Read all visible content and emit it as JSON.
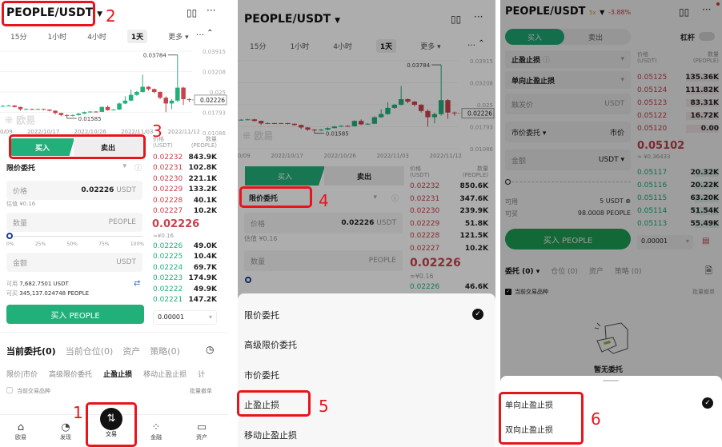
{
  "pair": "PEOPLE/USDT",
  "timeframes": [
    "15分",
    "1小时",
    "4小时",
    "1天",
    "更多"
  ],
  "selected_timeframe": "1天",
  "chart": {
    "type": "candlestick",
    "y_ticks": [
      "0.03915",
      "0.03208",
      "0.025",
      "0.01793",
      "0.01086"
    ],
    "x_ticks": [
      "0/09",
      "2022/10/17",
      "2022/10/26",
      "2022/11/03",
      "2022/11/12"
    ],
    "ylim": [
      0.01086,
      0.03915
    ],
    "high_label": "0.03784",
    "low_label": "0.01585",
    "last_price_label": "0.02226",
    "watermark": "欧易",
    "up_color": "#21b07a",
    "down_color": "#c9434c",
    "candles": [
      [
        0.02,
        0.0202,
        0.0204,
        0.0199
      ],
      [
        0.0202,
        0.0203,
        0.0205,
        0.02
      ],
      [
        0.0203,
        0.0198,
        0.0205,
        0.0196
      ],
      [
        0.0198,
        0.019,
        0.0199,
        0.0185
      ],
      [
        0.019,
        0.0191,
        0.0193,
        0.0188
      ],
      [
        0.0191,
        0.019,
        0.0192,
        0.0188
      ],
      [
        0.019,
        0.0191,
        0.0192,
        0.0189
      ],
      [
        0.0191,
        0.0189,
        0.0192,
        0.0187
      ],
      [
        0.0189,
        0.0185,
        0.019,
        0.0183
      ],
      [
        0.0185,
        0.0177,
        0.0186,
        0.0172
      ],
      [
        0.0177,
        0.017,
        0.0178,
        0.0166
      ],
      [
        0.017,
        0.0168,
        0.0172,
        0.01585
      ],
      [
        0.0168,
        0.017,
        0.0172,
        0.0165
      ],
      [
        0.017,
        0.0175,
        0.0177,
        0.0168
      ],
      [
        0.0175,
        0.018,
        0.0182,
        0.0174
      ],
      [
        0.018,
        0.0182,
        0.0184,
        0.0178
      ],
      [
        0.0182,
        0.0181,
        0.0184,
        0.0179
      ],
      [
        0.0181,
        0.0198,
        0.02,
        0.018
      ],
      [
        0.0198,
        0.0187,
        0.0203,
        0.0185
      ],
      [
        0.0187,
        0.0189,
        0.0191,
        0.0186
      ],
      [
        0.0189,
        0.021,
        0.0213,
        0.0188
      ],
      [
        0.021,
        0.022,
        0.0235,
        0.0208
      ],
      [
        0.022,
        0.024,
        0.0258,
        0.0218
      ],
      [
        0.024,
        0.025,
        0.0253,
        0.0237
      ],
      [
        0.025,
        0.0268,
        0.031,
        0.0248
      ],
      [
        0.0268,
        0.026,
        0.027,
        0.0255
      ],
      [
        0.026,
        0.025,
        0.0262,
        0.0245
      ],
      [
        0.025,
        0.023,
        0.0252,
        0.0225
      ],
      [
        0.023,
        0.021,
        0.0235,
        0.018
      ],
      [
        0.021,
        0.022,
        0.0225,
        0.019
      ],
      [
        0.022,
        0.0265,
        0.03784,
        0.0215
      ],
      [
        0.0265,
        0.0225,
        0.0268,
        0.0205
      ],
      [
        0.0225,
        0.02226,
        0.0228,
        0.0215
      ]
    ]
  },
  "buy": "买入",
  "sell": "卖出",
  "order_type": "限价委托",
  "price_label": "价格",
  "price_value": "0.02226",
  "unit_usdt": "USDT",
  "unit_people": "PEOPLE",
  "estimate": "估值 ¥0.16",
  "qty_label": "数量",
  "amount_label": "金额",
  "slider": [
    "0%",
    "25%",
    "50%",
    "75%",
    "100%"
  ],
  "avail_label": "可用",
  "avail_value": "7,682.7501 USDT",
  "canbuy_label": "可买",
  "canbuy_value": "345,137.024748 PEOPLE",
  "buy_button": "买入 PEOPLE",
  "ob_head": {
    "price": "价格",
    "price_unit": "(USDT)",
    "qty": "数量",
    "qty_unit": "(PEOPLE)"
  },
  "p1": {
    "asks": [
      [
        "0.02232",
        "843.9K"
      ],
      [
        "0.02231",
        "102.8K"
      ],
      [
        "0.02230",
        "221.1K"
      ],
      [
        "0.02229",
        "133.2K"
      ],
      [
        "0.02228",
        "40.1K"
      ],
      [
        "0.02227",
        "10.2K"
      ]
    ],
    "mid": "0.02226",
    "mid_cny": "≈¥0.16",
    "bids": [
      [
        "0.02226",
        "49.0K"
      ],
      [
        "0.02225",
        "10.4K"
      ],
      [
        "0.02224",
        "69.7K"
      ],
      [
        "0.02223",
        "174.9K"
      ],
      [
        "0.02222",
        "49.9K"
      ],
      [
        "0.02221",
        "147.2K"
      ]
    ],
    "tick": "0.00001",
    "tabs": [
      "当前委托(0)",
      "当前仓位(0)",
      "资产",
      "策略(0)"
    ],
    "subtabs": [
      "限价|市价",
      "高级限价委托",
      "止盈止损",
      "移动止盈止损",
      "计"
    ],
    "current_pair": "当前交易品种",
    "batch_cancel": "批量撤单",
    "nav": [
      "欧易",
      "发现",
      "交易",
      "金融",
      "资产"
    ]
  },
  "p2": {
    "asks": [
      [
        "0.02232",
        "850.6K"
      ],
      [
        "0.02231",
        "347.6K"
      ],
      [
        "0.02230",
        "239.9K"
      ],
      [
        "0.02229",
        "51.8K"
      ],
      [
        "0.02228",
        "121.5K"
      ],
      [
        "0.02227",
        "10.2K"
      ]
    ],
    "mid": "0.02226",
    "mid_cny": "≈¥0.16",
    "bid0": [
      "0.02226",
      "46.6K"
    ],
    "menu": [
      "限价委托",
      "高级限价委托",
      "市价委托",
      "止盈止损",
      "移动止盈止损"
    ]
  },
  "p3": {
    "leverage_badge": "5x",
    "change": "-3.88%",
    "leverage_label": "杠杆",
    "order_type": "止盈止损",
    "sub_type": "单向止盈止损",
    "trigger": "触发价",
    "market_order": "市价委托",
    "market": "市价",
    "avail_value": "5 USDT",
    "canbuy_value": "98.0008 PEOPLE",
    "asks": [
      [
        "0.05125",
        "135.36K"
      ],
      [
        "0.05124",
        "111.82K"
      ],
      [
        "0.05123",
        "83.31K"
      ],
      [
        "0.05122",
        "16.72K"
      ],
      [
        "0.05120",
        "0.00"
      ]
    ],
    "mid": "0.05102",
    "mid_cny": "≈ ¥0.36433",
    "bids": [
      [
        "0.05117",
        "20.32K"
      ],
      [
        "0.05116",
        "20.22K"
      ],
      [
        "0.05115",
        "63.20K"
      ],
      [
        "0.05114",
        "51.54K"
      ],
      [
        "0.05113",
        "55.49K"
      ]
    ],
    "tick": "0.00001",
    "tabs": [
      "委托 (0)",
      "仓位 (0)",
      "资产",
      "策略 (0)"
    ],
    "current_pair": "当前交易品种",
    "batch_cancel": "批量撤单",
    "empty": "暂无委托",
    "menu": [
      "单向止盈止损",
      "双向止盈止损"
    ]
  },
  "annotations": [
    "1",
    "2",
    "3",
    "4",
    "5",
    "6"
  ]
}
